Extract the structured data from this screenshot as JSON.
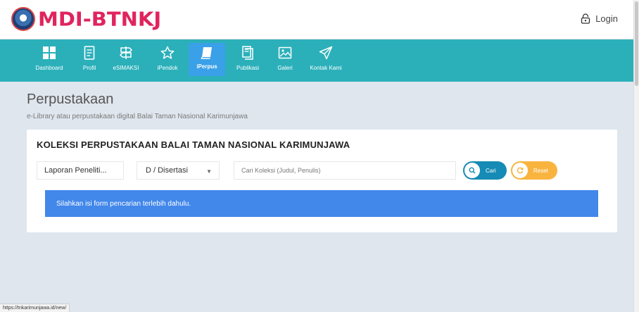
{
  "header": {
    "logo_text": "MDI-BTNKJ",
    "login_label": "Login"
  },
  "nav": {
    "items": [
      {
        "label": "Dashboard",
        "icon": "dashboard-icon"
      },
      {
        "label": "Profil",
        "icon": "document-icon"
      },
      {
        "label": "eSIMAKSI",
        "icon": "signpost-icon"
      },
      {
        "label": "iPendok",
        "icon": "star-icon"
      },
      {
        "label": "iPerpus",
        "icon": "book-icon",
        "active": true
      },
      {
        "label": "Publikasi",
        "icon": "files-icon"
      },
      {
        "label": "Galeri",
        "icon": "image-icon"
      },
      {
        "label": "Kontak Kami",
        "icon": "send-icon"
      }
    ]
  },
  "page": {
    "title": "Perpustakaan",
    "subtitle": "e-Library atau perpustakaan digital Balai Taman Nasional Karimunjawa"
  },
  "card": {
    "title": "KOLEKSI PERPUSTAKAAN BALAI TAMAN NASIONAL KARIMUNJAWA",
    "filter_type": "Laporan Peneliti...",
    "filter_degree": "D / Disertasi",
    "search_placeholder": "Cari Koleksi (Judul, Penulis)",
    "search_value": "",
    "search_button": "Cari",
    "reset_button": "Reset",
    "alert": "Silahkan isi form pencarian terlebih dahulu."
  },
  "status_bar": {
    "url": "https://tnkarimunjawa.id/new/"
  },
  "colors": {
    "navbar": "#2bb0ba",
    "nav_active": "#3aa0e8",
    "brand": "#e0245e",
    "search_button": "#158bb5",
    "reset_button": "#f9b440",
    "alert": "#4287ea",
    "background": "#dfe6ee"
  }
}
